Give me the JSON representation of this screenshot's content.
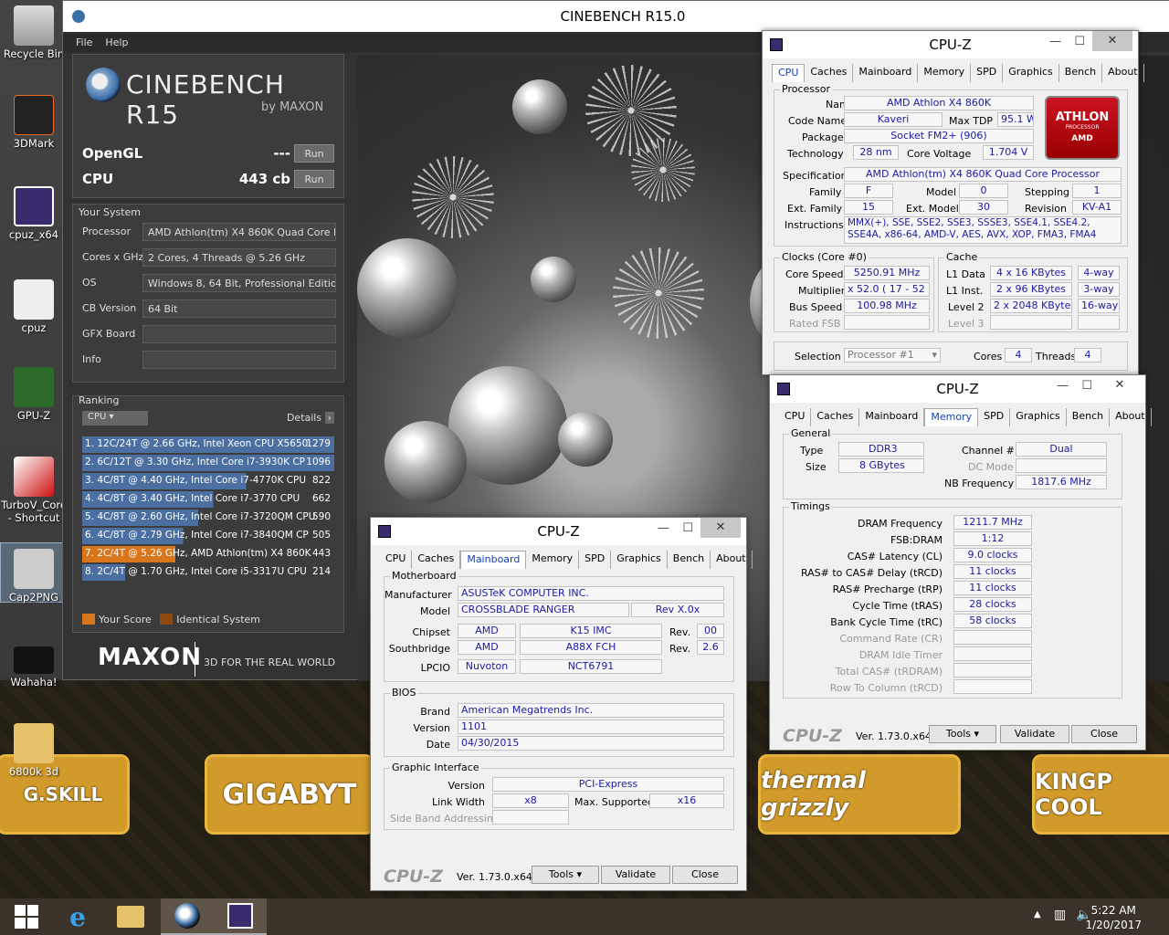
{
  "desktop": {
    "icons": [
      {
        "label": "Recycle Bin"
      },
      {
        "label": "3DMark"
      },
      {
        "label": "cpuz_x64"
      },
      {
        "label": "cpuz"
      },
      {
        "label": "GPU-Z"
      },
      {
        "label": "TurboV_Core - Shortcut"
      },
      {
        "label": "Cap2PNG"
      },
      {
        "label": "Wahaha!"
      },
      {
        "label": "6800k 3d"
      }
    ],
    "sponsors": [
      "G.SKILL",
      "GIGABYT",
      "thermal grizzly",
      "KINGP COOL"
    ]
  },
  "cinebench": {
    "title": "CINEBENCH R15.0",
    "menu": [
      "File",
      "Help"
    ],
    "logo_main": "CINEBENCH R15",
    "logo_sub": "by MAXON",
    "opengl_label": "OpenGL",
    "opengl_value": "---",
    "cpu_label": "CPU",
    "cpu_value": "443 cb",
    "run": "Run",
    "your_system": "Your System",
    "system": [
      {
        "k": "Processor",
        "v": "AMD Athlon(tm) X4 860K Quad Core Prc"
      },
      {
        "k": "Cores x GHz",
        "v": "2 Cores, 4 Threads @ 5.26 GHz"
      },
      {
        "k": "OS",
        "v": "Windows 8, 64 Bit, Professional Edition"
      },
      {
        "k": "CB Version",
        "v": "64 Bit"
      },
      {
        "k": "GFX Board",
        "v": ""
      },
      {
        "k": "Info",
        "v": ""
      }
    ],
    "ranking": "Ranking",
    "rank_select": "CPU",
    "details": "Details",
    "ranks": [
      {
        "t": "1. 12C/24T @ 2.66 GHz, Intel Xeon CPU X5650",
        "s": "1279"
      },
      {
        "t": "2. 6C/12T @ 3.30 GHz,  Intel Core i7-3930K CP",
        "s": "1096"
      },
      {
        "t": "3. 4C/8T @ 4.40 GHz, Intel Core i7-4770K CPU",
        "s": "822"
      },
      {
        "t": "4. 4C/8T @ 3.40 GHz,  Intel Core i7-3770 CPU",
        "s": "662"
      },
      {
        "t": "5. 4C/8T @ 2.60 GHz, Intel Core i7-3720QM CPU",
        "s": "590"
      },
      {
        "t": "6. 4C/8T @ 2.79 GHz,  Intel Core i7-3840QM CP",
        "s": "505"
      },
      {
        "t": "7. 2C/4T @ 5.26 GHz, AMD Athlon(tm) X4 860K",
        "s": "443"
      },
      {
        "t": "8. 2C/4T @ 1.70 GHz,  Intel Core i5-3317U CPU",
        "s": "214"
      }
    ],
    "legend_your": "Your Score",
    "legend_ident": "Identical System",
    "maxon": "MAXON",
    "slogan": "3D FOR THE REAL WORLD"
  },
  "cpuz_cpu": {
    "title": "CPU-Z",
    "tabs": [
      "CPU",
      "Caches",
      "Mainboard",
      "Memory",
      "SPD",
      "Graphics",
      "Bench",
      "About"
    ],
    "processor": "Processor",
    "name": "AMD Athlon X4 860K",
    "code_name": "Kaveri",
    "max_tdp": "95.1 W",
    "package": "Socket FM2+ (906)",
    "technology": "28 nm",
    "core_voltage": "1.704 V",
    "specification": "AMD Athlon(tm) X4 860K Quad Core Processor",
    "family": "F",
    "model": "0",
    "stepping": "1",
    "ext_family": "15",
    "ext_model": "30",
    "revision": "KV-A1",
    "instructions": "MMX(+), SSE, SSE2, SSE3, SSSE3, SSE4.1, SSE4.2, SSE4A, x86-64, AMD-V, AES, AVX, XOP, FMA3, FMA4",
    "logo_top": "ATHLON",
    "logo_mid": "PROCESSOR",
    "logo_bot": "AMD",
    "clocks": "Clocks (Core #0)",
    "core_speed": "5250.91 MHz",
    "multiplier": "x 52.0 ( 17 - 52 )",
    "bus_speed": "100.98 MHz",
    "rated_fsb": "Rated FSB",
    "cache": "Cache",
    "l1d": "4 x 16 KBytes",
    "l1d_w": "4-way",
    "l1i": "2 x 96 KBytes",
    "l1i_w": "3-way",
    "l2": "2 x 2048 KBytes",
    "l2_w": "16-way",
    "l3": "Level 3",
    "selection": "Selection",
    "selection_val": "Processor #1",
    "cores": "4",
    "threads": "4",
    "labels": {
      "name": "Name",
      "code": "Code Name",
      "tdp": "Max TDP",
      "pkg": "Package",
      "tech": "Technology",
      "cv": "Core Voltage",
      "spec": "Specification",
      "fam": "Family",
      "mod": "Model",
      "step": "Stepping",
      "efam": "Ext. Family",
      "emod": "Ext. Model",
      "rev": "Revision",
      "ins": "Instructions",
      "cs": "Core Speed",
      "mul": "Multiplier",
      "bus": "Bus Speed",
      "l1dl": "L1 Data",
      "l1il": "L1 Inst.",
      "l2l": "Level 2",
      "cores": "Cores",
      "threads": "Threads"
    }
  },
  "cpuz_mem": {
    "title": "CPU-Z",
    "tabs": [
      "CPU",
      "Caches",
      "Mainboard",
      "Memory",
      "SPD",
      "Graphics",
      "Bench",
      "About"
    ],
    "general": "General",
    "type": "DDR3",
    "size": "8 GBytes",
    "channel": "Dual",
    "dc_mode": "DC Mode",
    "nb_freq": "1817.6 MHz",
    "timings": "Timings",
    "rows": [
      {
        "k": "DRAM Frequency",
        "v": "1211.7 MHz"
      },
      {
        "k": "FSB:DRAM",
        "v": "1:12"
      },
      {
        "k": "CAS# Latency (CL)",
        "v": "9.0 clocks"
      },
      {
        "k": "RAS# to CAS# Delay (tRCD)",
        "v": "11 clocks"
      },
      {
        "k": "RAS# Precharge (tRP)",
        "v": "11 clocks"
      },
      {
        "k": "Cycle Time (tRAS)",
        "v": "28 clocks"
      },
      {
        "k": "Bank Cycle Time (tRC)",
        "v": "58 clocks"
      }
    ],
    "grey_rows": [
      "Command Rate (CR)",
      "DRAM Idle Timer",
      "Total CAS# (tRDRAM)",
      "Row To Column (tRCD)"
    ],
    "labels": {
      "type": "Type",
      "size": "Size",
      "channel": "Channel #",
      "nb": "NB Frequency"
    },
    "brand": "CPU-Z",
    "ver": "Ver. 1.73.0.x64",
    "tools": "Tools",
    "validate": "Validate",
    "close": "Close"
  },
  "cpuz_mb": {
    "title": "CPU-Z",
    "tabs": [
      "CPU",
      "Caches",
      "Mainboard",
      "Memory",
      "SPD",
      "Graphics",
      "Bench",
      "About"
    ],
    "motherboard": "Motherboard",
    "manufacturer": "ASUSTeK COMPUTER INC.",
    "model": "CROSSBLADE RANGER",
    "rev": "Rev X.0x",
    "chipset_v": "AMD",
    "chipset_m": "K15 IMC",
    "chipset_r": "00",
    "south_v": "AMD",
    "south_m": "A88X FCH",
    "south_r": "2.6",
    "lpcio_v": "Nuvoton",
    "lpcio_m": "NCT6791",
    "bios": "BIOS",
    "brand": "American Megatrends Inc.",
    "version": "1101",
    "date": "04/30/2015",
    "gi": "Graphic Interface",
    "gi_version": "PCI-Express",
    "link_width": "x8",
    "max_supported": "x16",
    "side_band": "Side Band Addressing",
    "labels": {
      "man": "Manufacturer",
      "model": "Model",
      "chip": "Chipset",
      "south": "Southbridge",
      "lpcio": "LPCIO",
      "rev": "Rev.",
      "brand": "Brand",
      "ver": "Version",
      "date": "Date",
      "giv": "Version",
      "lw": "Link Width",
      "ms": "Max. Supported"
    },
    "footbrand": "CPU-Z",
    "ver": "Ver. 1.73.0.x64",
    "tools": "Tools",
    "validate": "Validate",
    "close": "Close"
  },
  "taskbar": {
    "time": "5:22 AM",
    "date": "1/20/2017"
  }
}
